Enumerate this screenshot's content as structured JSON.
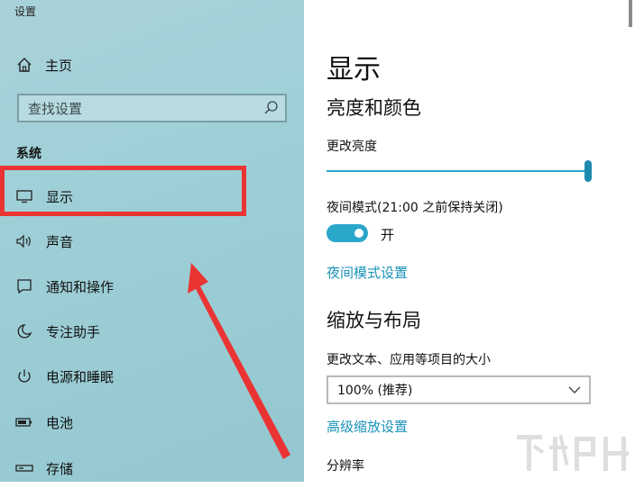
{
  "window": {
    "title": "设置"
  },
  "sidebar": {
    "home_label": "主页",
    "search_placeholder": "查找设置",
    "section_title": "系统",
    "items": [
      {
        "label": "显示",
        "icon": "monitor-icon"
      },
      {
        "label": "声音",
        "icon": "speaker-icon"
      },
      {
        "label": "通知和操作",
        "icon": "notification-icon"
      },
      {
        "label": "专注助手",
        "icon": "moon-icon"
      },
      {
        "label": "电源和睡眠",
        "icon": "power-icon"
      },
      {
        "label": "电池",
        "icon": "battery-icon"
      },
      {
        "label": "存储",
        "icon": "storage-icon"
      }
    ]
  },
  "main": {
    "title": "显示",
    "brightness_section": "亮度和颜色",
    "brightness_label": "更改亮度",
    "brightness_value": 1.0,
    "night_mode_label": "夜间模式(21:00 之前保持关闭)",
    "night_mode_state": "开",
    "night_mode_link": "夜间模式设置",
    "scale_section": "缩放与布局",
    "scale_label": "更改文本、应用等项目的大小",
    "scale_value": "100% (推荐)",
    "advanced_scale_link": "高级缩放设置",
    "resolution_label": "分辨率"
  },
  "colors": {
    "accent": "#28a6c8",
    "highlight_box": "#ea3434",
    "link": "#1a92b8"
  }
}
